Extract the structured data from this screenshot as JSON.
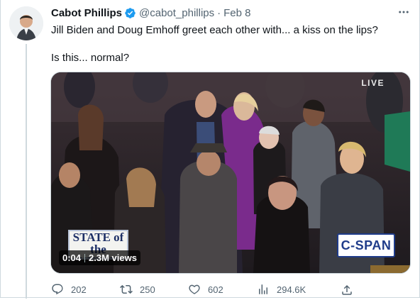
{
  "tweet": {
    "author_name": "Cabot Phillips",
    "handle": "@cabot_phillips",
    "dot": "·",
    "date": "Feb 8",
    "text_lines": [
      "Jill Biden and Doug Emhoff greet each other with... a kiss on the lips?",
      "Is this... normal?"
    ],
    "verified": true,
    "colors": {
      "verified": "#1d9bf0",
      "secondary_text": "#536471",
      "border": "#cfd9de"
    }
  },
  "media": {
    "live_badge": "LIVE",
    "logo_state_of_the_union": "STATE of the UNION",
    "logo_network": "C-SPAN",
    "timestamp": "0:04",
    "views": "2.3M views"
  },
  "actions": {
    "replies": "202",
    "retweets": "250",
    "likes": "602",
    "analytics": "294.6K"
  },
  "icons": [
    "verified-badge-icon",
    "more-icon",
    "reply-icon",
    "retweet-icon",
    "like-icon",
    "analytics-icon",
    "share-icon"
  ]
}
